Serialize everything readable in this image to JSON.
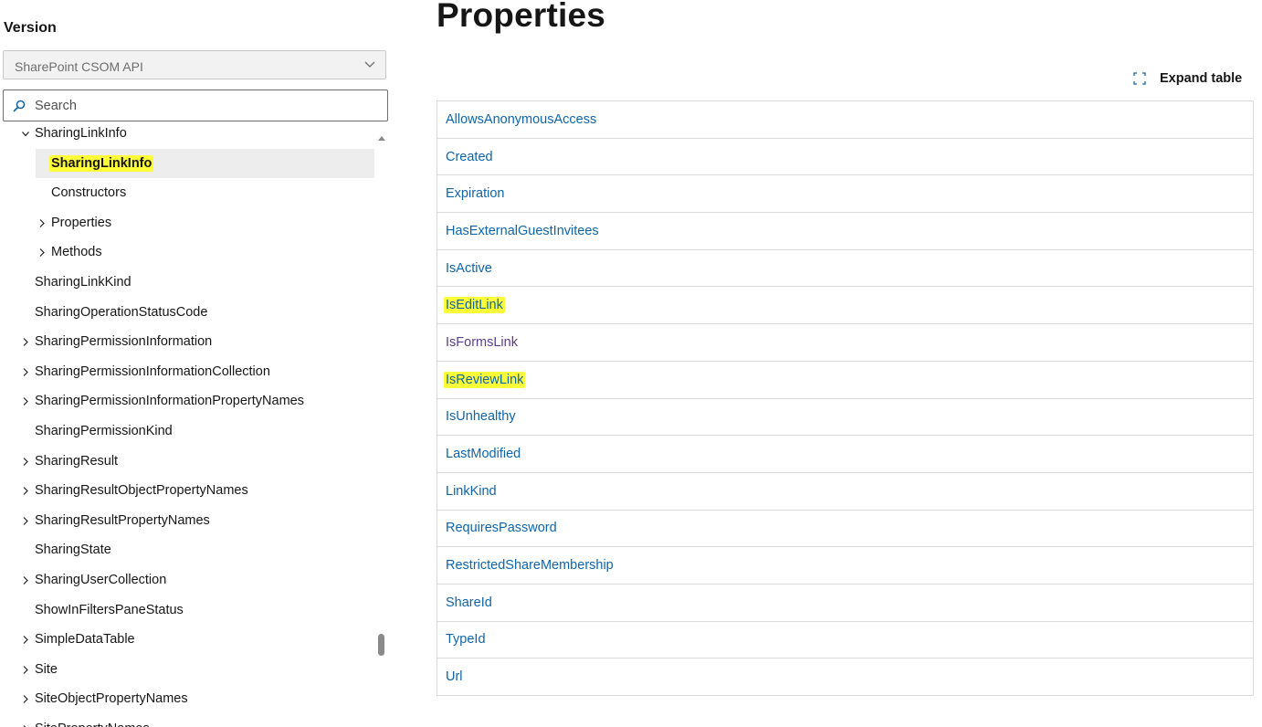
{
  "sidebar": {
    "version_label": "Version",
    "version_select": {
      "value": "SharePoint CSOM API"
    },
    "search": {
      "placeholder": "Search"
    },
    "tree": [
      {
        "label": "SharingLinkInfo",
        "level": 0,
        "chevron": "down",
        "cut_top": true
      },
      {
        "label": "SharingLinkInfo",
        "level": 1,
        "chevron": "none",
        "selected": true,
        "highlighted": true
      },
      {
        "label": "Constructors",
        "level": 1,
        "chevron": "none"
      },
      {
        "label": "Properties",
        "level": 1,
        "chevron": "right"
      },
      {
        "label": "Methods",
        "level": 1,
        "chevron": "right"
      },
      {
        "label": "SharingLinkKind",
        "level": 0,
        "chevron": "none"
      },
      {
        "label": "SharingOperationStatusCode",
        "level": 0,
        "chevron": "none"
      },
      {
        "label": "SharingPermissionInformation",
        "level": 0,
        "chevron": "right"
      },
      {
        "label": "SharingPermissionInformationCollection",
        "level": 0,
        "chevron": "right"
      },
      {
        "label": "SharingPermissionInformationPropertyNames",
        "level": 0,
        "chevron": "right"
      },
      {
        "label": "SharingPermissionKind",
        "level": 0,
        "chevron": "none"
      },
      {
        "label": "SharingResult",
        "level": 0,
        "chevron": "right"
      },
      {
        "label": "SharingResultObjectPropertyNames",
        "level": 0,
        "chevron": "right"
      },
      {
        "label": "SharingResultPropertyNames",
        "level": 0,
        "chevron": "right"
      },
      {
        "label": "SharingState",
        "level": 0,
        "chevron": "none"
      },
      {
        "label": "SharingUserCollection",
        "level": 0,
        "chevron": "right"
      },
      {
        "label": "ShowInFiltersPaneStatus",
        "level": 0,
        "chevron": "none"
      },
      {
        "label": "SimpleDataTable",
        "level": 0,
        "chevron": "right"
      },
      {
        "label": "Site",
        "level": 0,
        "chevron": "right"
      },
      {
        "label": "SiteObjectPropertyNames",
        "level": 0,
        "chevron": "right"
      },
      {
        "label": "SitePropertyNames",
        "level": 0,
        "chevron": "right"
      }
    ]
  },
  "main": {
    "title": "Properties",
    "expand_table_label": "Expand table",
    "properties": [
      {
        "name": "AllowsAnonymousAccess"
      },
      {
        "name": "Created"
      },
      {
        "name": "Expiration"
      },
      {
        "name": "HasExternalGuestInvitees"
      },
      {
        "name": "IsActive"
      },
      {
        "name": "IsEditLink",
        "highlighted": true
      },
      {
        "name": "IsFormsLink",
        "visited": true
      },
      {
        "name": "IsReviewLink",
        "highlighted": true
      },
      {
        "name": "IsUnhealthy"
      },
      {
        "name": "LastModified"
      },
      {
        "name": "LinkKind"
      },
      {
        "name": "RequiresPassword"
      },
      {
        "name": "RestrictedShareMembership"
      },
      {
        "name": "ShareId"
      },
      {
        "name": "TypeId"
      },
      {
        "name": "Url"
      }
    ]
  },
  "colors": {
    "link": "#0f64a8",
    "visited_link": "#5c3d8d",
    "highlight": "#ffff39",
    "selected_bg": "#ededed"
  }
}
